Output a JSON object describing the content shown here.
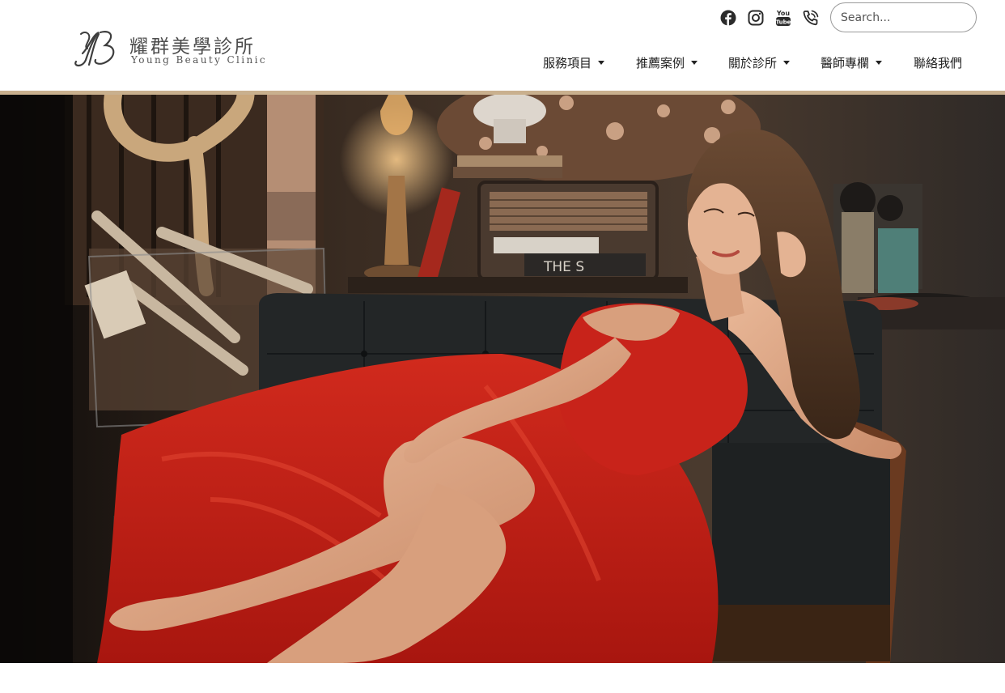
{
  "brand": {
    "name_cn": "耀群美學診所",
    "name_en": "Young Beauty Clinic",
    "mark": "YB"
  },
  "social": [
    {
      "icon": "facebook-icon"
    },
    {
      "icon": "instagram-icon"
    },
    {
      "icon": "youtube-icon",
      "text": "You Tube"
    },
    {
      "icon": "phone-icon"
    }
  ],
  "search": {
    "placeholder": "Search...",
    "value": ""
  },
  "nav": {
    "items": [
      {
        "label": "服務項目",
        "dropdown": true
      },
      {
        "label": "推薦案例",
        "dropdown": true
      },
      {
        "label": "關於診所",
        "dropdown": true
      },
      {
        "label": "醫師專欄",
        "dropdown": true
      },
      {
        "label": "聯絡我們",
        "dropdown": false
      }
    ]
  },
  "hero": {
    "image": "banner-photo-woman-red-dress-on-leather-sofa",
    "radio_text": "THE S"
  },
  "colors": {
    "accent_bar": "#c9b08e",
    "text": "#222222",
    "dress": "#c8231a"
  }
}
